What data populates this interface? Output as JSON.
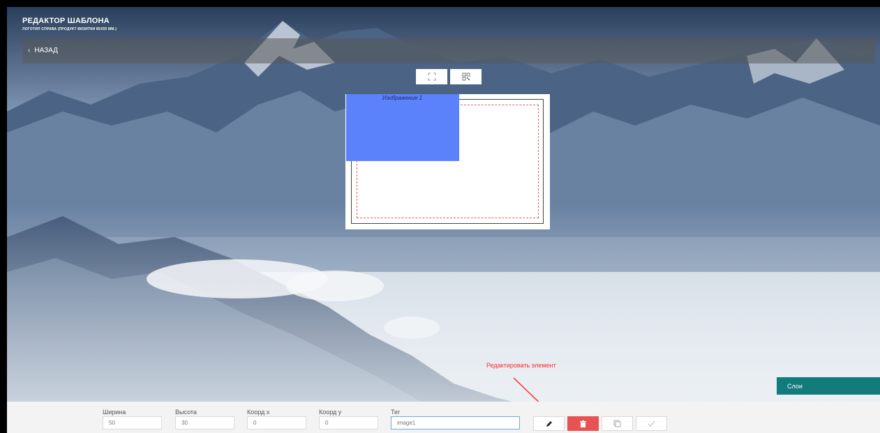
{
  "header": {
    "title": "РЕДАКТОР ШАБЛОНА",
    "subtitle": "ЛОГОТИП СПРАВА (ПРОДУКТ ВИЗИТКИ 85Х55 ММ.)"
  },
  "nav": {
    "back_label": "НАЗАД"
  },
  "toolbar": {
    "fullscreen_icon": "fullscreen-icon",
    "qr_icon": "qr-code-icon"
  },
  "canvas": {
    "image_label": "Изображение 1",
    "image_color": "#5b82fb"
  },
  "annotation": {
    "text": "Редактировать элемент",
    "color": "#ff2a2a"
  },
  "layers": {
    "label": "Слои",
    "color": "#127b7b"
  },
  "properties": {
    "width_label": "Ширина",
    "width_value": "50",
    "height_label": "Высота",
    "height_value": "30",
    "x_label": "Коорд х",
    "x_value": "0",
    "y_label": "Коорд у",
    "y_value": "0",
    "tag_label": "Тег",
    "tag_value": "image1"
  },
  "actions": {
    "edit_icon": "pencil-icon",
    "delete_icon": "trash-icon",
    "duplicate_icon": "copy-icon",
    "confirm_icon": "check-icon",
    "delete_color": "#e55353"
  }
}
